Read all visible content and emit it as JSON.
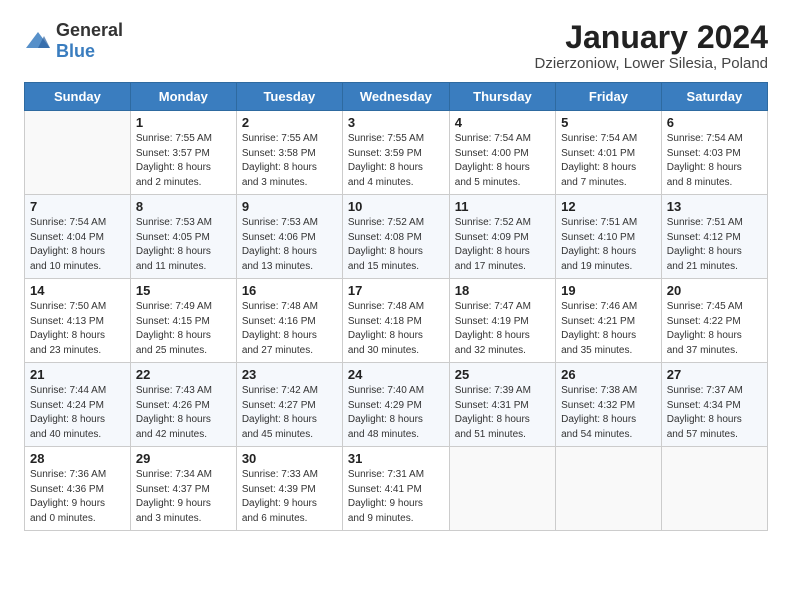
{
  "header": {
    "logo_general": "General",
    "logo_blue": "Blue",
    "title": "January 2024",
    "subtitle": "Dzierzoniow, Lower Silesia, Poland"
  },
  "days_of_week": [
    "Sunday",
    "Monday",
    "Tuesday",
    "Wednesday",
    "Thursday",
    "Friday",
    "Saturday"
  ],
  "weeks": [
    [
      {
        "day": "",
        "info": ""
      },
      {
        "day": "1",
        "info": "Sunrise: 7:55 AM\nSunset: 3:57 PM\nDaylight: 8 hours\nand 2 minutes."
      },
      {
        "day": "2",
        "info": "Sunrise: 7:55 AM\nSunset: 3:58 PM\nDaylight: 8 hours\nand 3 minutes."
      },
      {
        "day": "3",
        "info": "Sunrise: 7:55 AM\nSunset: 3:59 PM\nDaylight: 8 hours\nand 4 minutes."
      },
      {
        "day": "4",
        "info": "Sunrise: 7:54 AM\nSunset: 4:00 PM\nDaylight: 8 hours\nand 5 minutes."
      },
      {
        "day": "5",
        "info": "Sunrise: 7:54 AM\nSunset: 4:01 PM\nDaylight: 8 hours\nand 7 minutes."
      },
      {
        "day": "6",
        "info": "Sunrise: 7:54 AM\nSunset: 4:03 PM\nDaylight: 8 hours\nand 8 minutes."
      }
    ],
    [
      {
        "day": "7",
        "info": "Sunrise: 7:54 AM\nSunset: 4:04 PM\nDaylight: 8 hours\nand 10 minutes."
      },
      {
        "day": "8",
        "info": "Sunrise: 7:53 AM\nSunset: 4:05 PM\nDaylight: 8 hours\nand 11 minutes."
      },
      {
        "day": "9",
        "info": "Sunrise: 7:53 AM\nSunset: 4:06 PM\nDaylight: 8 hours\nand 13 minutes."
      },
      {
        "day": "10",
        "info": "Sunrise: 7:52 AM\nSunset: 4:08 PM\nDaylight: 8 hours\nand 15 minutes."
      },
      {
        "day": "11",
        "info": "Sunrise: 7:52 AM\nSunset: 4:09 PM\nDaylight: 8 hours\nand 17 minutes."
      },
      {
        "day": "12",
        "info": "Sunrise: 7:51 AM\nSunset: 4:10 PM\nDaylight: 8 hours\nand 19 minutes."
      },
      {
        "day": "13",
        "info": "Sunrise: 7:51 AM\nSunset: 4:12 PM\nDaylight: 8 hours\nand 21 minutes."
      }
    ],
    [
      {
        "day": "14",
        "info": "Sunrise: 7:50 AM\nSunset: 4:13 PM\nDaylight: 8 hours\nand 23 minutes."
      },
      {
        "day": "15",
        "info": "Sunrise: 7:49 AM\nSunset: 4:15 PM\nDaylight: 8 hours\nand 25 minutes."
      },
      {
        "day": "16",
        "info": "Sunrise: 7:48 AM\nSunset: 4:16 PM\nDaylight: 8 hours\nand 27 minutes."
      },
      {
        "day": "17",
        "info": "Sunrise: 7:48 AM\nSunset: 4:18 PM\nDaylight: 8 hours\nand 30 minutes."
      },
      {
        "day": "18",
        "info": "Sunrise: 7:47 AM\nSunset: 4:19 PM\nDaylight: 8 hours\nand 32 minutes."
      },
      {
        "day": "19",
        "info": "Sunrise: 7:46 AM\nSunset: 4:21 PM\nDaylight: 8 hours\nand 35 minutes."
      },
      {
        "day": "20",
        "info": "Sunrise: 7:45 AM\nSunset: 4:22 PM\nDaylight: 8 hours\nand 37 minutes."
      }
    ],
    [
      {
        "day": "21",
        "info": "Sunrise: 7:44 AM\nSunset: 4:24 PM\nDaylight: 8 hours\nand 40 minutes."
      },
      {
        "day": "22",
        "info": "Sunrise: 7:43 AM\nSunset: 4:26 PM\nDaylight: 8 hours\nand 42 minutes."
      },
      {
        "day": "23",
        "info": "Sunrise: 7:42 AM\nSunset: 4:27 PM\nDaylight: 8 hours\nand 45 minutes."
      },
      {
        "day": "24",
        "info": "Sunrise: 7:40 AM\nSunset: 4:29 PM\nDaylight: 8 hours\nand 48 minutes."
      },
      {
        "day": "25",
        "info": "Sunrise: 7:39 AM\nSunset: 4:31 PM\nDaylight: 8 hours\nand 51 minutes."
      },
      {
        "day": "26",
        "info": "Sunrise: 7:38 AM\nSunset: 4:32 PM\nDaylight: 8 hours\nand 54 minutes."
      },
      {
        "day": "27",
        "info": "Sunrise: 7:37 AM\nSunset: 4:34 PM\nDaylight: 8 hours\nand 57 minutes."
      }
    ],
    [
      {
        "day": "28",
        "info": "Sunrise: 7:36 AM\nSunset: 4:36 PM\nDaylight: 9 hours\nand 0 minutes."
      },
      {
        "day": "29",
        "info": "Sunrise: 7:34 AM\nSunset: 4:37 PM\nDaylight: 9 hours\nand 3 minutes."
      },
      {
        "day": "30",
        "info": "Sunrise: 7:33 AM\nSunset: 4:39 PM\nDaylight: 9 hours\nand 6 minutes."
      },
      {
        "day": "31",
        "info": "Sunrise: 7:31 AM\nSunset: 4:41 PM\nDaylight: 9 hours\nand 9 minutes."
      },
      {
        "day": "",
        "info": ""
      },
      {
        "day": "",
        "info": ""
      },
      {
        "day": "",
        "info": ""
      }
    ]
  ]
}
